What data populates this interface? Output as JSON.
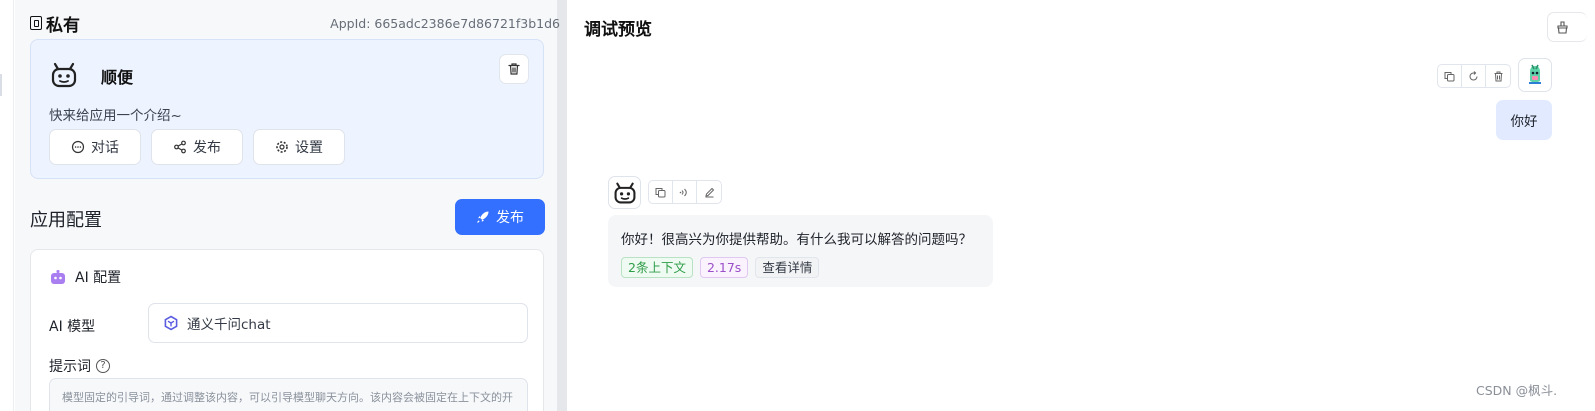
{
  "app": {
    "section_title": "私有",
    "appid": "AppId: 665adc2386e7d86721f3b1d6",
    "name": "顺便",
    "intro": "快来给应用一个介绍~",
    "buttons": [
      "对话",
      "发布",
      "设置"
    ]
  },
  "config": {
    "title": "应用配置",
    "publish_label": "发布",
    "ai_section_title": "AI 配置",
    "model_label": "AI 模型",
    "model_value": "通义千问chat",
    "prompt_label": "提示词",
    "prompt_help": "?",
    "prompt_placeholder": "模型固定的引导词，通过调整该内容，可以引导模型聊天方向。该内容会被固定在上下文的开"
  },
  "preview": {
    "title": "调试预览",
    "user_message": "你好",
    "bot_message": "你好！很高兴为你提供帮助。有什么我可以解答的问题吗？",
    "tags": [
      "2条上下文",
      "2.17s",
      "查看详情"
    ]
  },
  "colors": {
    "accent": "#3370ff",
    "card_bg": "#edf3ff",
    "user_bubble": "#e1eaff",
    "tag_green": "#2e9d48",
    "tag_purple": "#9b4fc9"
  },
  "icons": [
    "lock-icon",
    "robot-icon",
    "trash-icon",
    "chat-icon",
    "share-icon",
    "gear-icon",
    "rocket-icon",
    "ai-bot-icon",
    "qwen-icon",
    "help-icon",
    "copy-icon",
    "refresh-icon",
    "speaker-icon",
    "edit-icon",
    "user-avatar-icon"
  ],
  "watermark": "CSDN @枫斗."
}
